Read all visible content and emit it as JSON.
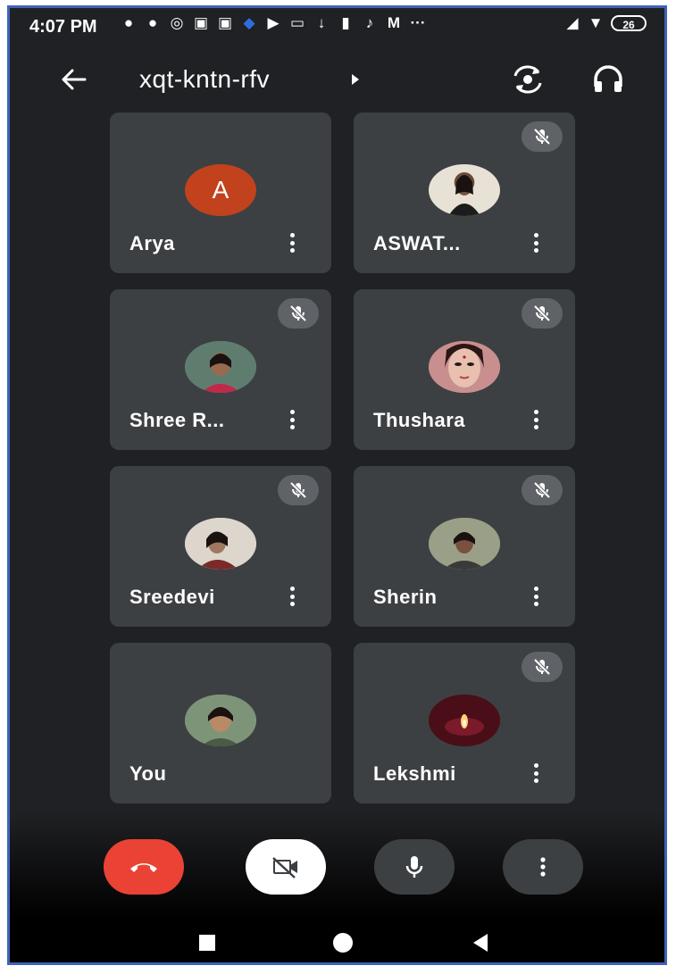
{
  "status_bar": {
    "time": "4:07 PM",
    "battery": "26",
    "icons": [
      "alert-icon",
      "chat-icon",
      "whatsapp-icon",
      "picture-icon",
      "picture-icon",
      "blue-app-icon",
      "youtube-icon",
      "video-icon",
      "download-icon",
      "keyhole-icon",
      "tiktok-icon",
      "gmail-icon",
      "more-icon",
      "signal-icon",
      "wifi-icon",
      "battery-icon"
    ]
  },
  "header": {
    "meeting_code": "xqt-kntn-rfv"
  },
  "participants": [
    {
      "name": "Arya",
      "avatar_letter": "A",
      "muted": false,
      "avatar_color": "#c1421d"
    },
    {
      "name": "ASWAT...",
      "muted": true,
      "avatar_color": "#d9d0c4"
    },
    {
      "name": "Shree R...",
      "muted": true,
      "avatar_color": "#8b4a3d"
    },
    {
      "name": "Thushara",
      "muted": true,
      "avatar_color": "#c98e8e"
    },
    {
      "name": "Sreedevi",
      "muted": true,
      "avatar_color": "#9a7a6a"
    },
    {
      "name": "Sherin",
      "muted": true,
      "avatar_color": "#a4a692"
    },
    {
      "name": "You",
      "muted": false,
      "avatar_color": "#8a9a82"
    },
    {
      "name": "Lekshmi",
      "muted": true,
      "avatar_color": "#5a1320"
    }
  ],
  "controls": {
    "end_call_color": "#ea4335",
    "camera": "off",
    "microphone": "on"
  }
}
